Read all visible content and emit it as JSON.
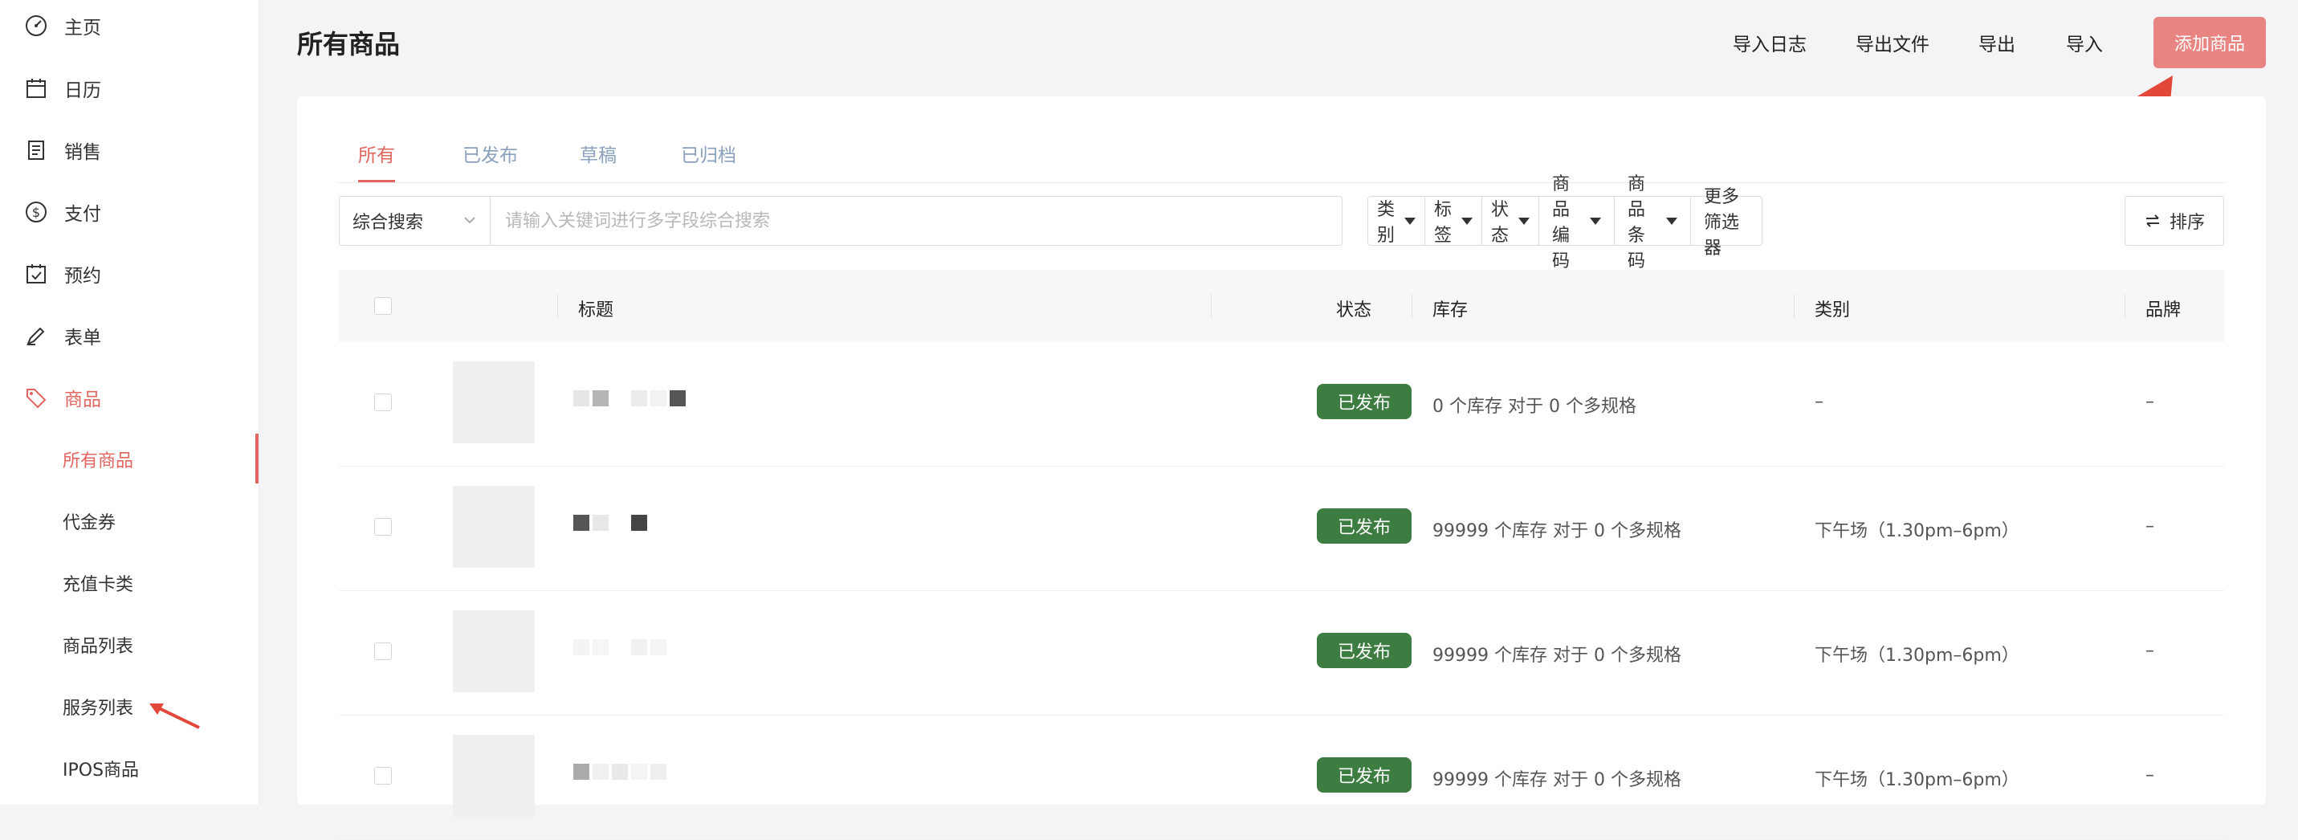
{
  "sidebar": {
    "items": [
      {
        "label": "主页",
        "icon": "dashboard-gauge-icon"
      },
      {
        "label": "日历",
        "icon": "calendar-icon"
      },
      {
        "label": "销售",
        "icon": "receipt-icon"
      },
      {
        "label": "支付",
        "icon": "dollar-circle-icon"
      },
      {
        "label": "预约",
        "icon": "calendar-check-icon"
      },
      {
        "label": "表单",
        "icon": "pen-icon"
      },
      {
        "label": "商品",
        "icon": "tag-icon"
      }
    ],
    "sub_items": [
      {
        "label": "所有商品"
      },
      {
        "label": "代金券"
      },
      {
        "label": "充值卡类"
      },
      {
        "label": "商品列表"
      },
      {
        "label": "服务列表"
      },
      {
        "label": "IPOS商品"
      }
    ]
  },
  "header": {
    "title": "所有商品",
    "links": [
      "导入日志",
      "导出文件",
      "导出",
      "导入"
    ],
    "add_button": "添加商品"
  },
  "tabs": [
    "所有",
    "已发布",
    "草稿",
    "已归档"
  ],
  "search": {
    "mode": "综合搜索",
    "placeholder": "请输入关键词进行多字段综合搜索"
  },
  "filters": [
    "类别",
    "标签",
    "状态",
    "商品编码",
    "商品条码",
    "更多筛选器"
  ],
  "sort_label": "排序",
  "table": {
    "columns": [
      "标题",
      "状态",
      "库存",
      "类别",
      "品牌"
    ],
    "rows": [
      {
        "status": "已发布",
        "stock": "0 个库存 对于 0 个多规格",
        "category": "–",
        "brand": "–"
      },
      {
        "status": "已发布",
        "stock": "99999 个库存 对于 0 个多规格",
        "category": "下午场（1.30pm–6pm）",
        "brand": "–"
      },
      {
        "status": "已发布",
        "stock": "99999 个库存 对于 0 个多规格",
        "category": "下午场（1.30pm–6pm）",
        "brand": "–"
      },
      {
        "status": "已发布",
        "stock": "99999 个库存 对于 0 个多规格",
        "category": "下午场（1.30pm–6pm）",
        "brand": "–"
      }
    ]
  },
  "colors": {
    "accent": "#e2665f",
    "published_badge": "#3d7d42",
    "add_button": "#e88583"
  }
}
